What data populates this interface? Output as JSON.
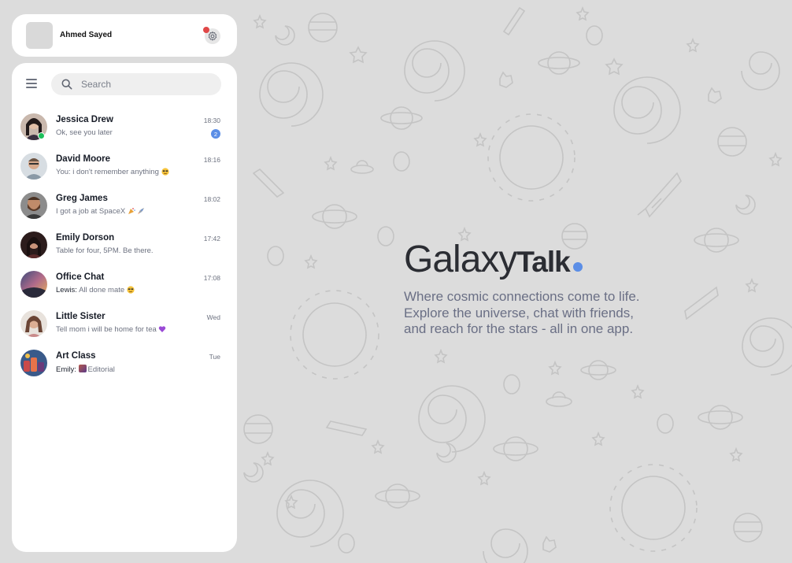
{
  "user": {
    "name": "Ahmed Sayed"
  },
  "search": {
    "placeholder": "Search"
  },
  "chats": [
    {
      "name": "Jessica Drew",
      "preview": "Ok, see you later",
      "time": "18:30",
      "unread": "2",
      "online": true
    },
    {
      "name": "David Moore",
      "preview": "You: i don't remember anything",
      "time": "18:16"
    },
    {
      "name": "Greg James",
      "preview": "I got a job at SpaceX",
      "time": "18:02"
    },
    {
      "name": "Emily Dorson",
      "preview": "Table for four, 5PM. Be there.",
      "time": "17:42"
    },
    {
      "name": "Office Chat",
      "sender": "Lewis:",
      "preview": "All done mate",
      "time": "17:08"
    },
    {
      "name": "Little Sister",
      "preview": "Tell mom i will be home for tea",
      "time": "Wed"
    },
    {
      "name": "Art Class",
      "sender": "Emily:",
      "preview": "Editorial",
      "time": "Tue"
    }
  ],
  "brand": {
    "name_light": "Galaxy",
    "name_bold": "Talk",
    "tagline_lines": [
      "Where cosmic connections come to life.",
      "Explore the universe, chat with friends,",
      "and reach for the stars - all in one app."
    ],
    "accent_color": "#5b8ee6"
  },
  "colors": {
    "background": "#dcdcdc",
    "panel": "#ffffff",
    "online": "#1dbf5a",
    "notification": "#e04848"
  },
  "icons": [
    "settings-gear-icon",
    "hamburger-menu-icon",
    "search-icon",
    "sunglasses-emoji-icon",
    "party-popper-emoji-icon",
    "rocket-emoji-icon",
    "purple-heart-emoji-icon"
  ]
}
